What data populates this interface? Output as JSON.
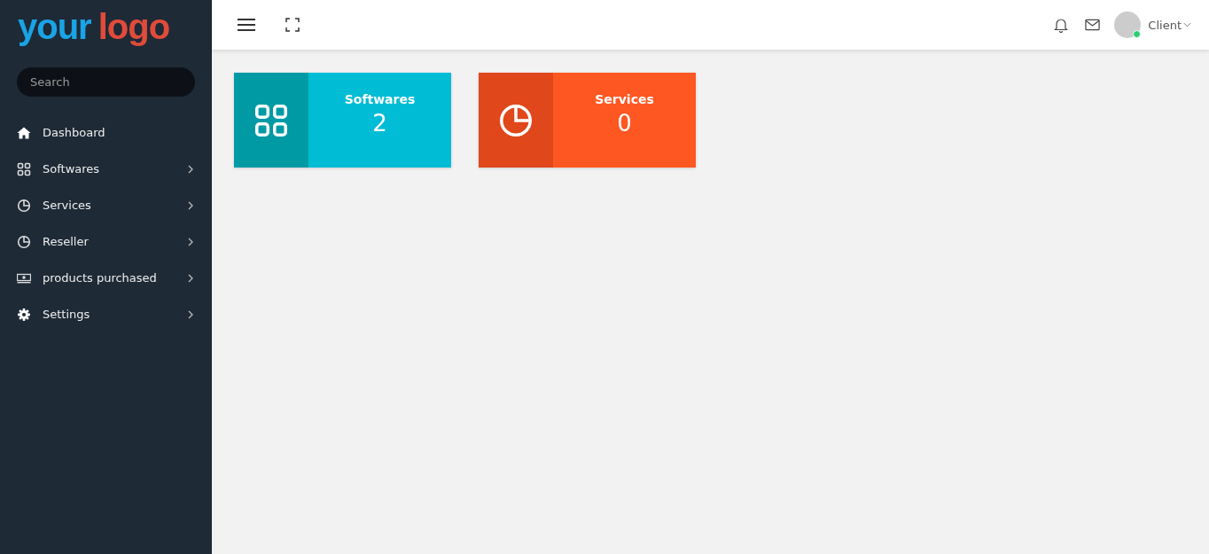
{
  "logo": {
    "part_1": "your",
    "part_2": "logo"
  },
  "search": {
    "placeholder": "Search"
  },
  "sidebar": {
    "items": [
      {
        "label": "Dashboard",
        "kind": "home",
        "has_submenu": false
      },
      {
        "label": "Softwares",
        "kind": "grid",
        "has_submenu": true
      },
      {
        "label": "Services",
        "kind": "pie",
        "has_submenu": true
      },
      {
        "label": "Reseller",
        "kind": "pie",
        "has_submenu": true
      },
      {
        "label": "products purchased",
        "kind": "money",
        "has_submenu": true
      },
      {
        "label": "Settings",
        "kind": "gear",
        "has_submenu": true
      }
    ]
  },
  "header": {
    "user": {
      "name": "Client",
      "online": true
    }
  },
  "cards": [
    {
      "title": "Softwares",
      "count": "2",
      "kind": "grid",
      "color": "#00bcd4"
    },
    {
      "title": "Services",
      "count": "0",
      "kind": "pie",
      "color": "#ff5722"
    }
  ]
}
